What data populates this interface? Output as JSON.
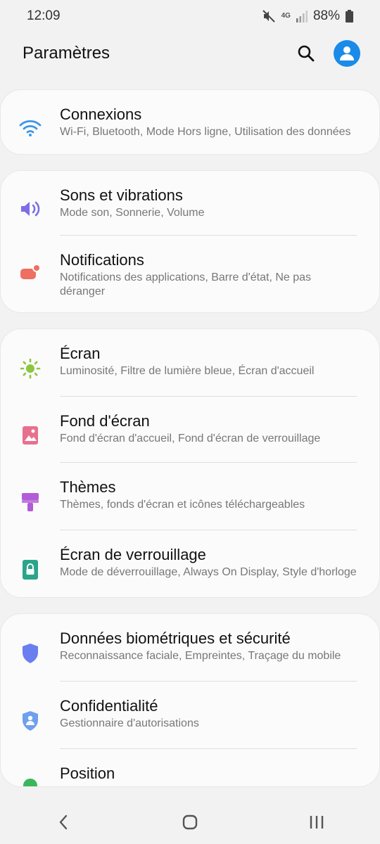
{
  "status": {
    "time": "12:09",
    "network": "4G",
    "battery": "88%"
  },
  "header": {
    "title": "Paramètres",
    "search_icon": "search-icon",
    "profile_icon": "account-icon"
  },
  "groups": [
    {
      "items": [
        {
          "title": "Connexions",
          "subtitle": "Wi-Fi, Bluetooth, Mode Hors ligne, Utilisation des données",
          "icon": "wifi-icon",
          "color": "#3b97e8"
        }
      ]
    },
    {
      "items": [
        {
          "title": "Sons et vibrations",
          "subtitle": "Mode son, Sonnerie, Volume",
          "icon": "volume-icon",
          "color": "#7b6fe8"
        },
        {
          "title": "Notifications",
          "subtitle": "Notifications des applications, Barre d'état, Ne pas déranger",
          "icon": "notification-icon",
          "color": "#ee6f61"
        }
      ]
    },
    {
      "items": [
        {
          "title": "Écran",
          "subtitle": "Luminosité, Filtre de lumière bleue, Écran d'accueil",
          "icon": "brightness-icon",
          "color": "#8cc63e"
        },
        {
          "title": "Fond d'écran",
          "subtitle": "Fond d'écran d'accueil, Fond d'écran de verrouillage",
          "icon": "wallpaper-icon",
          "color": "#e8708f"
        },
        {
          "title": "Thèmes",
          "subtitle": "Thèmes, fonds d'écran et icônes téléchargeables",
          "icon": "theme-brush-icon",
          "color": "#b25bd6"
        },
        {
          "title": "Écran de verrouillage",
          "subtitle": "Mode de déverrouillage, Always On Display, Style d'horloge",
          "icon": "lock-icon",
          "color": "#2aa58a"
        }
      ]
    },
    {
      "items": [
        {
          "title": "Données biométriques et sécurité",
          "subtitle": "Reconnaissance faciale, Empreintes, Traçage du mobile",
          "icon": "shield-icon",
          "color": "#6a7ef0"
        },
        {
          "title": "Confidentialité",
          "subtitle": "Gestionnaire d'autorisations",
          "icon": "privacy-icon",
          "color": "#6ea0ee"
        },
        {
          "title": "Position",
          "subtitle": "",
          "icon": "location-icon",
          "color": "#3ab65c"
        }
      ]
    }
  ],
  "nav": {
    "back_icon": "back-icon",
    "home_icon": "home-icon",
    "recents_icon": "recents-icon"
  }
}
